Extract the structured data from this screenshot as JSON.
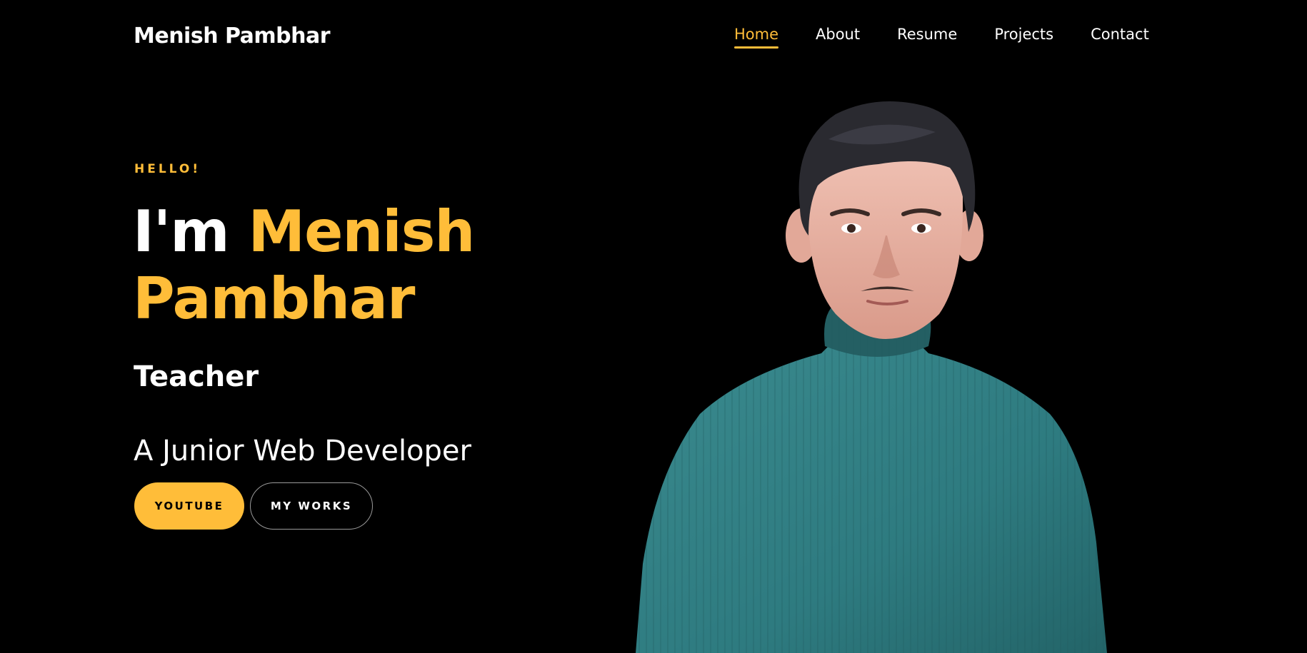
{
  "header": {
    "brand": "Menish Pambhar",
    "nav": [
      {
        "label": "Home",
        "active": true
      },
      {
        "label": "About",
        "active": false
      },
      {
        "label": "Resume",
        "active": false
      },
      {
        "label": "Projects",
        "active": false
      },
      {
        "label": "Contact",
        "active": false
      }
    ]
  },
  "hero": {
    "greeting": "HELLO!",
    "headline_prefix": "I'm ",
    "headline_name": "Menish Pambhar",
    "role": "Teacher",
    "tagline": "A Junior Web Developer",
    "buttons": {
      "youtube": "YOUTUBE",
      "works": "MY WORKS"
    }
  },
  "colors": {
    "accent": "#ffbd39",
    "background": "#000000",
    "text": "#ffffff",
    "sweater": "#2e7b80"
  }
}
